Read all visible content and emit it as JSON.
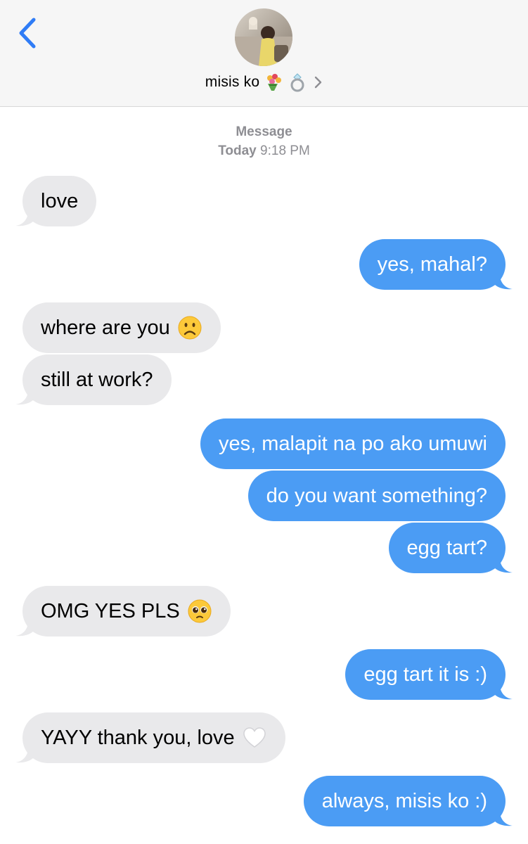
{
  "header": {
    "contact_name": "misis ko",
    "emojis": [
      "bouquet-icon",
      "ring-icon"
    ],
    "back_icon": "chevron-left-icon",
    "disclosure_icon": "chevron-right-icon"
  },
  "thread": {
    "service": "Message",
    "day": "Today",
    "time": "9:18 PM"
  },
  "messages": [
    {
      "side": "in",
      "text": "love"
    },
    {
      "side": "out",
      "text": "yes, mahal?"
    },
    {
      "side": "in",
      "text": "where are you",
      "emoji": "frowning-face-icon"
    },
    {
      "side": "in",
      "text": "still at work?"
    },
    {
      "side": "out",
      "text": "yes, malapit na po ako umuwi"
    },
    {
      "side": "out",
      "text": "do you want something?"
    },
    {
      "side": "out",
      "text": "egg tart?"
    },
    {
      "side": "in",
      "text": "OMG YES PLS",
      "emoji": "pleading-face-icon"
    },
    {
      "side": "out",
      "text": "egg tart it is :)"
    },
    {
      "side": "in",
      "text": "YAYY thank you, love",
      "emoji": "white-heart-icon"
    },
    {
      "side": "out",
      "text": "always, misis ko :)"
    }
  ],
  "colors": {
    "outgoing_bubble": "#4b9cf4",
    "incoming_bubble": "#e9e9eb",
    "accent_blue": "#2f7cf6",
    "meta_gray": "#8e8e93"
  }
}
